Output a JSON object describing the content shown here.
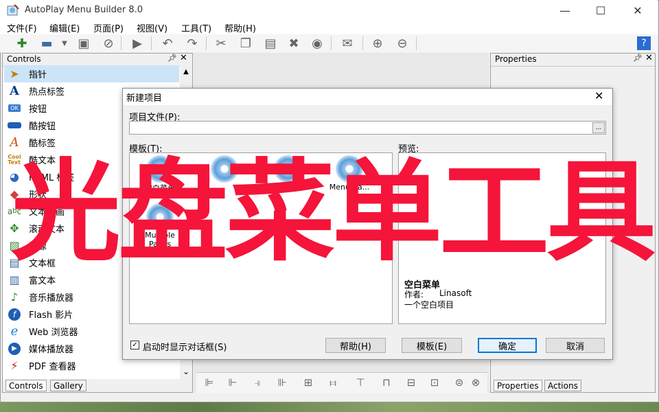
{
  "app": {
    "title": "AutoPlay Menu Builder 8.0"
  },
  "window_controls": {
    "minimize": "—",
    "maximize": "☐",
    "close": "✕"
  },
  "menu": [
    "文件(F)",
    "编辑(E)",
    "页面(P)",
    "视图(V)",
    "工具(T)",
    "帮助(H)"
  ],
  "controls_panel": {
    "title": "Controls",
    "items": [
      {
        "label": "指针",
        "icon": "pointer-icon"
      },
      {
        "label": "热点标签",
        "icon": "hotspot-label-icon"
      },
      {
        "label": "按钮",
        "icon": "button-icon"
      },
      {
        "label": "酷按钮",
        "icon": "cool-button-icon"
      },
      {
        "label": "酷标签",
        "icon": "cool-label-icon"
      },
      {
        "label": "酷文本",
        "icon": "cool-text-icon"
      },
      {
        "label": "HTML 标签",
        "icon": "html-label-icon"
      },
      {
        "label": "形状",
        "icon": "shape-icon"
      },
      {
        "label": "文本动画",
        "icon": "text-animation-icon"
      },
      {
        "label": "滚动文本",
        "icon": "scroll-text-icon"
      },
      {
        "label": "图像",
        "icon": "image-icon"
      },
      {
        "label": "文本框",
        "icon": "textbox-icon"
      },
      {
        "label": "富文本",
        "icon": "rich-text-icon"
      },
      {
        "label": "音乐播放器",
        "icon": "music-player-icon"
      },
      {
        "label": "Flash 影片",
        "icon": "flash-icon"
      },
      {
        "label": "Web 浏览器",
        "icon": "web-browser-icon"
      },
      {
        "label": "媒体播放器",
        "icon": "media-player-icon"
      },
      {
        "label": "PDF 查看器",
        "icon": "pdf-viewer-icon"
      }
    ],
    "tabs": [
      "Controls",
      "Gallery"
    ]
  },
  "properties_panel": {
    "title": "Properties",
    "tabs": [
      "Properties",
      "Actions"
    ]
  },
  "dialog": {
    "title": "新建项目",
    "file_label": "项目文件(P):",
    "file_value": "",
    "browse": "...",
    "template_label": "模板(T):",
    "preview_label": "预览:",
    "templates": [
      "空白菜单",
      "",
      "Music Sh...",
      "Menu Ba...",
      "Multiple Pages"
    ],
    "preview": {
      "name": "空白菜单",
      "author_label": "作者:",
      "author": "Linasoft",
      "description": "一个空白项目"
    },
    "show_on_start": "启动时显示对话框(S)",
    "buttons": {
      "help": "帮助(H)",
      "template": "模板(E)",
      "ok": "确定",
      "cancel": "取消"
    }
  },
  "overlay_text": "光盘菜单工具",
  "colors": {
    "overlay": "#f5143a",
    "selection": "#cce4f7",
    "accent": "#0078d7"
  }
}
